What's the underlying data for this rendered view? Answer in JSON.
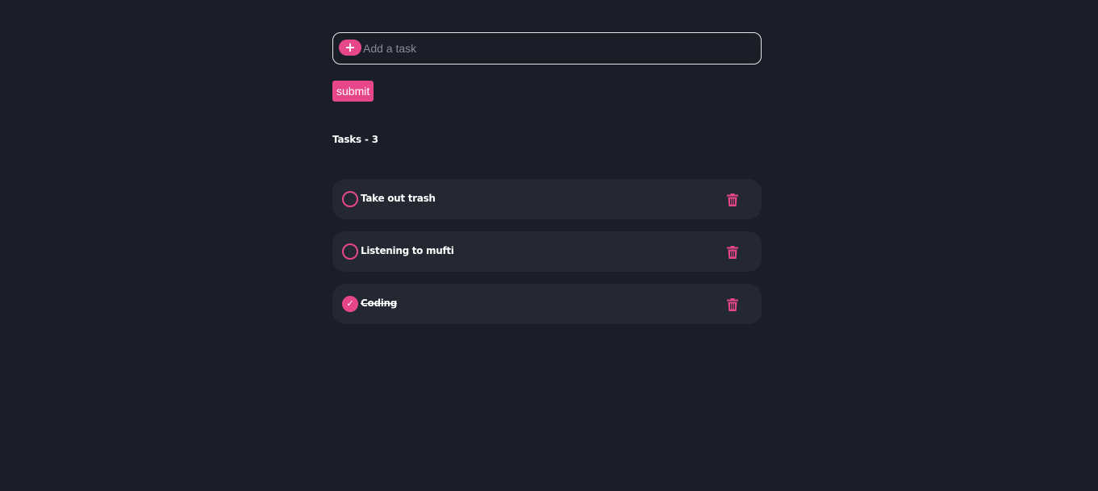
{
  "input": {
    "add_icon": "plus-icon",
    "placeholder": "Add a task",
    "value": ""
  },
  "submit_label": "submit",
  "tasks_heading": "Tasks - 3",
  "colors": {
    "background": "#1a1e29",
    "card": "#242833",
    "accent": "#e8468a",
    "text": "#ffffff"
  },
  "tasks": [
    {
      "text": "Take out trash",
      "done": false,
      "delete_icon": "trash-icon"
    },
    {
      "text": "Listening to mufti",
      "done": false,
      "delete_icon": "trash-icon"
    },
    {
      "text": "Coding",
      "done": true,
      "delete_icon": "trash-icon"
    }
  ]
}
